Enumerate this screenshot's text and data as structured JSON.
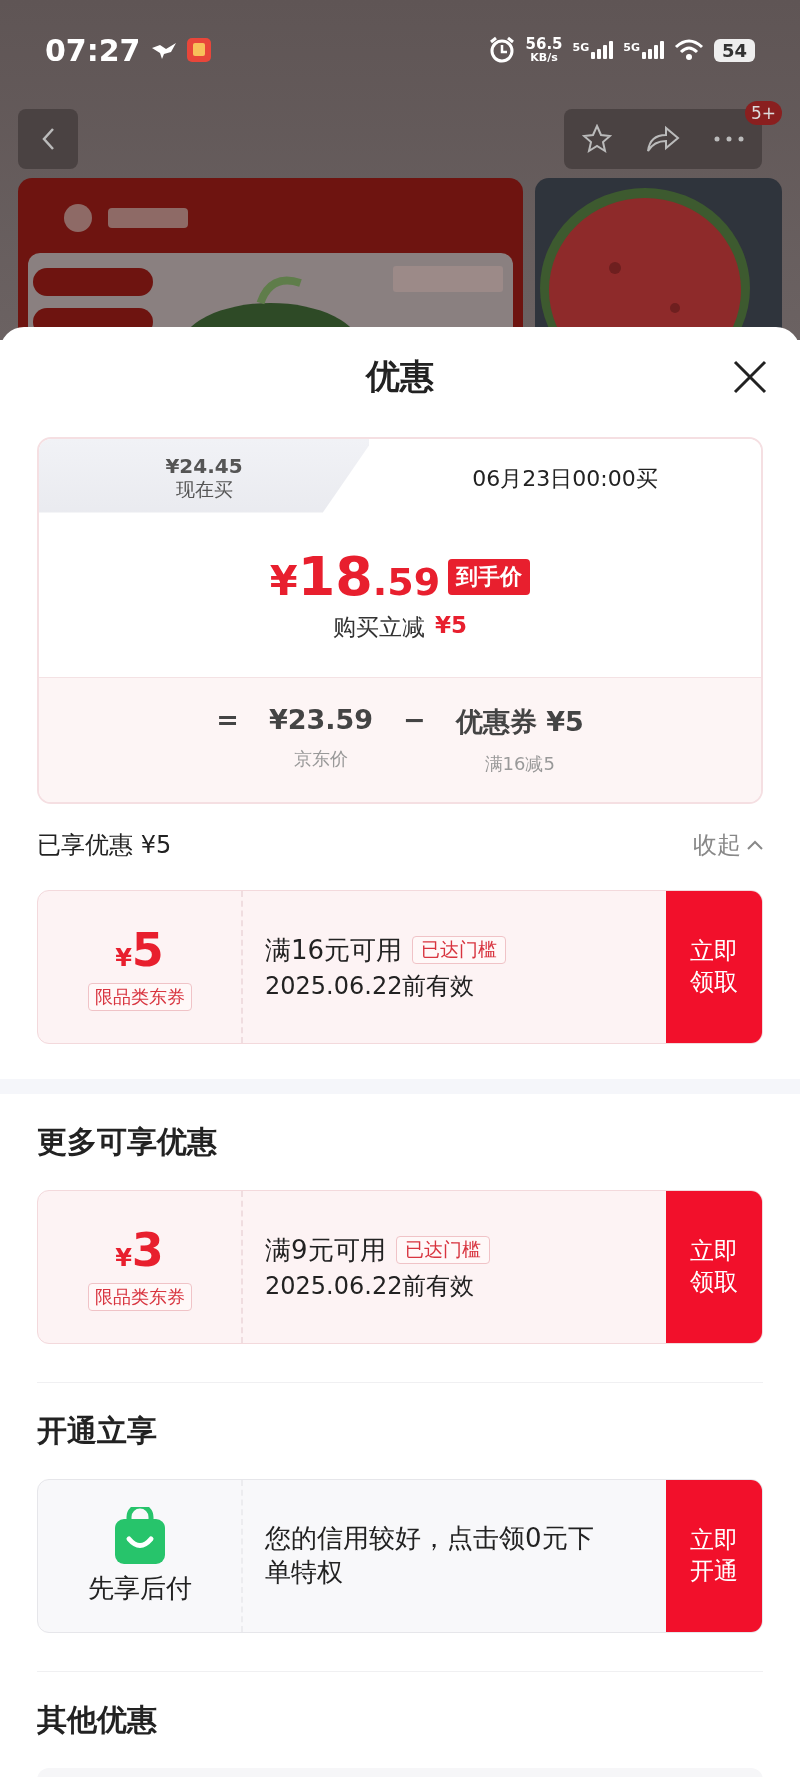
{
  "status_bar": {
    "time": "07:27",
    "net_speed": "56.5",
    "net_unit": "KB/s",
    "networks": [
      "5G",
      "5G"
    ],
    "battery": "54"
  },
  "nav": {
    "badge": "5+"
  },
  "sheet": {
    "title": "优惠",
    "price_tabs": [
      {
        "price": "¥24.45",
        "label": "现在买",
        "selected": false
      },
      {
        "label": "06月23日00:00买",
        "selected": true
      }
    ],
    "final_price": {
      "currency": "¥",
      "integer": "18",
      "decimal": ".59",
      "badge": "到手价"
    },
    "reduction": {
      "label": "购买立减",
      "amount": "¥5"
    },
    "formula": [
      {
        "kind": "operator",
        "text": "="
      },
      {
        "kind": "term",
        "text": "¥23.59",
        "caption": "京东价"
      },
      {
        "kind": "operator",
        "text": "−"
      },
      {
        "kind": "term",
        "text": "优惠券 ¥5",
        "caption": "满16减5"
      }
    ],
    "applied": {
      "label": "已享优惠 ¥5",
      "toggle": "收起"
    },
    "sections": [
      {
        "cards": [
          {
            "kind": "coupon",
            "currency": "¥",
            "amount": "5",
            "scope": "限品类东券",
            "condition": "满16元可用",
            "status": "已达门槛",
            "validity": "2025.06.22前有效",
            "action": "立即领取"
          }
        ]
      },
      {
        "title": "更多可享优惠",
        "cards": [
          {
            "kind": "coupon",
            "currency": "¥",
            "amount": "3",
            "scope": "限品类东券",
            "condition": "满9元可用",
            "status": "已达门槛",
            "validity": "2025.06.22前有效",
            "action": "立即领取"
          }
        ]
      },
      {
        "title": "开通立享",
        "cards": [
          {
            "kind": "service",
            "name": "先享后付",
            "description": "您的信用较好，点击领0元下单特权",
            "action": "立即开通"
          }
        ]
      },
      {
        "title": "其他优惠",
        "cards": [
          {
            "kind": "blank"
          }
        ]
      }
    ]
  }
}
